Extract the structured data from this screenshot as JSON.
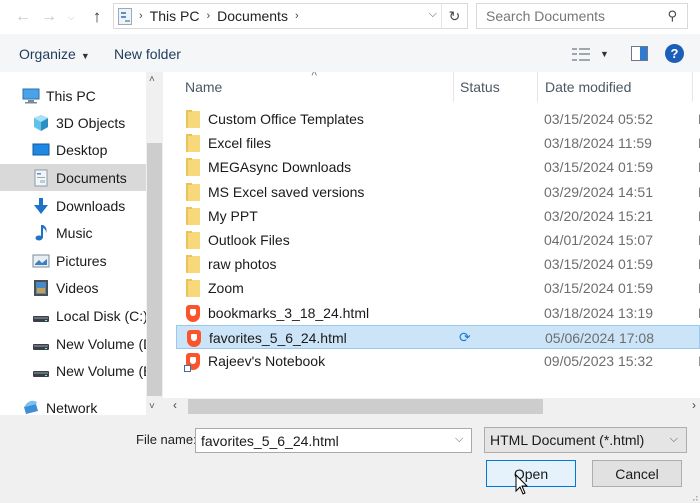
{
  "address_bar": {
    "back_icon": "arrow-left-icon",
    "forward_icon": "arrow-right-icon",
    "recent_icon": "chevron-down-icon",
    "up_icon": "arrow-up-icon",
    "breadcrumbs": [
      "This PC",
      "Documents"
    ],
    "refresh_icon": "refresh-icon",
    "search_placeholder": "Search Documents"
  },
  "toolbar": {
    "organize_label": "Organize",
    "new_folder_label": "New folder",
    "help_label": "?"
  },
  "sidebar": {
    "items": [
      {
        "label": "This PC",
        "icon": "computer-icon",
        "selected": false
      },
      {
        "label": "3D Objects",
        "icon": "cube-icon",
        "selected": false
      },
      {
        "label": "Desktop",
        "icon": "desktop-icon",
        "selected": false
      },
      {
        "label": "Documents",
        "icon": "document-icon",
        "selected": true
      },
      {
        "label": "Downloads",
        "icon": "download-icon",
        "selected": false
      },
      {
        "label": "Music",
        "icon": "music-icon",
        "selected": false
      },
      {
        "label": "Pictures",
        "icon": "pictures-icon",
        "selected": false
      },
      {
        "label": "Videos",
        "icon": "videos-icon",
        "selected": false
      },
      {
        "label": "Local Disk (C:)",
        "icon": "drive-icon",
        "selected": false
      },
      {
        "label": "New Volume (D:)",
        "icon": "drive-icon",
        "selected": false
      },
      {
        "label": "New Volume (E:)",
        "icon": "drive-icon",
        "selected": false
      },
      {
        "label": "Network",
        "icon": "network-icon",
        "selected": false
      }
    ]
  },
  "file_list": {
    "columns": [
      "Name",
      "Status",
      "Date modified",
      "T"
    ],
    "rows": [
      {
        "name": "Custom Office Templates",
        "icon": "folder-icon",
        "status": "",
        "date": "03/15/2024 05:52",
        "type": "F"
      },
      {
        "name": "Excel files",
        "icon": "folder-icon",
        "status": "",
        "date": "03/18/2024 11:59",
        "type": "F"
      },
      {
        "name": "MEGAsync Downloads",
        "icon": "folder-icon",
        "status": "",
        "date": "03/15/2024 01:59",
        "type": "F"
      },
      {
        "name": "MS Excel saved versions",
        "icon": "folder-icon",
        "status": "",
        "date": "03/29/2024 14:51",
        "type": "F"
      },
      {
        "name": "My PPT",
        "icon": "folder-icon",
        "status": "",
        "date": "03/20/2024 15:21",
        "type": "F"
      },
      {
        "name": "Outlook Files",
        "icon": "folder-icon",
        "status": "",
        "date": "04/01/2024 15:07",
        "type": "F"
      },
      {
        "name": "raw photos",
        "icon": "folder-icon",
        "status": "",
        "date": "03/15/2024 01:59",
        "type": "F"
      },
      {
        "name": "Zoom",
        "icon": "folder-icon",
        "status": "",
        "date": "03/15/2024 01:59",
        "type": "F"
      },
      {
        "name": "bookmarks_3_18_24.html",
        "icon": "brave-icon",
        "status": "",
        "date": "03/18/2024 13:19",
        "type": "B"
      },
      {
        "name": "favorites_5_6_24.html",
        "icon": "brave-icon",
        "status": "sync-icon",
        "date": "05/06/2024 17:08",
        "type": "B",
        "selected": true
      },
      {
        "name": "Rajeev's Notebook",
        "icon": "brave-shortcut-icon",
        "status": "",
        "date": "09/05/2023 15:32",
        "type": "I"
      }
    ]
  },
  "bottom": {
    "file_name_label": "File name:",
    "file_name_value": "favorites_5_6_24.html",
    "filter_value": "HTML Document (*.html)",
    "open_label": "Open",
    "cancel_label": "Cancel"
  },
  "colors": {
    "selection_bg": "#cce4f7",
    "selection_border": "#99c9ef",
    "accent": "#0078d7",
    "folder": "#f7d97c",
    "brave": "#fb542b"
  }
}
